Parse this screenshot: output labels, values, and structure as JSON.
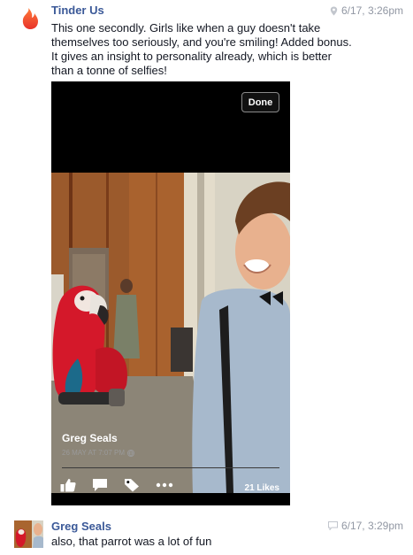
{
  "messages": [
    {
      "sender": "Tinder Us",
      "time": "6/17, 3:26pm",
      "text_lines": [
        "This one secondly. Girls like when a guy doesn't take",
        "themselves too seriously, and you're smiling! Added bonus.",
        "It gives an insight to personality already, which is better",
        "than a tonne of selfies!"
      ],
      "meta_icon": "location-pin-icon"
    },
    {
      "sender": "Greg Seals",
      "time": "6/17, 3:29pm",
      "text": "also, that parrot was a lot of fun",
      "meta_icon": "chat-bubble-icon"
    }
  ],
  "viewer": {
    "done_label": "Done",
    "owner_name": "Greg Seals",
    "timestamp": "26 MAY AT 7:07 PM",
    "timestamp_icon": "globe-icon",
    "likes": "21 Likes",
    "actions": [
      "like-icon",
      "comment-icon",
      "tag-icon",
      "more-icon"
    ]
  },
  "colors": {
    "sender_blue": "#3b5998",
    "meta_gray": "#9197a3",
    "tinder_red": "#ee3b29"
  }
}
